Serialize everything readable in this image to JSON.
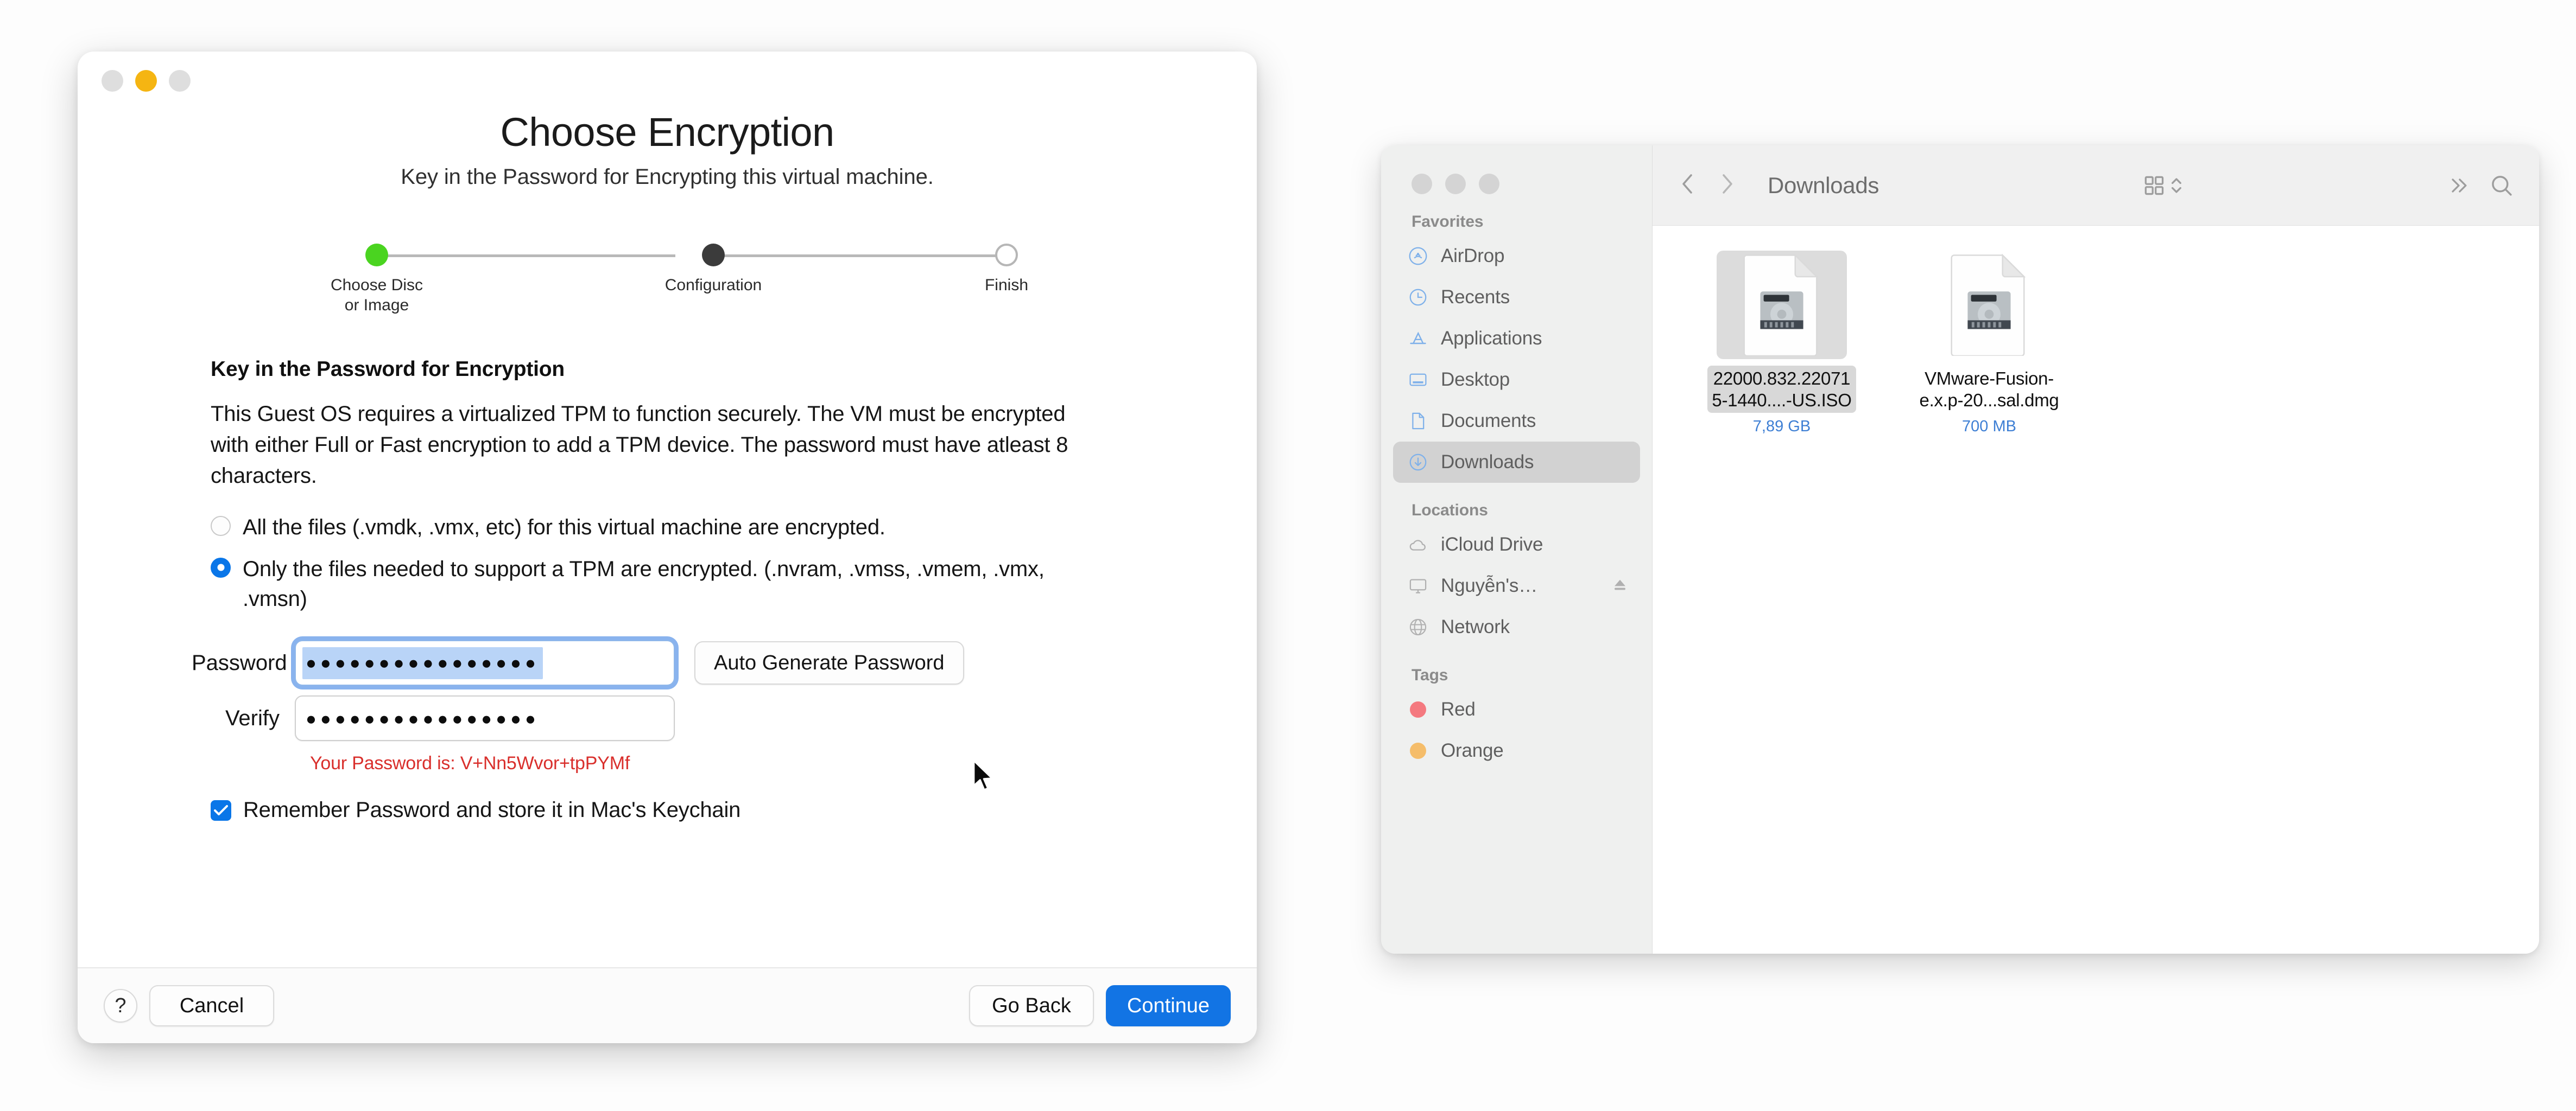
{
  "dialog": {
    "window_controls": {
      "close": "close-button",
      "minimize": "minimize-button",
      "zoom": "zoom-button"
    },
    "title": "Choose Encryption",
    "subtitle": "Key in the Password for Encrypting this virtual machine.",
    "stepper": {
      "steps": [
        {
          "label": "Choose Disc\nor Image",
          "state": "done"
        },
        {
          "label": "Configuration",
          "state": "current"
        },
        {
          "label": "Finish",
          "state": "todo"
        }
      ]
    },
    "section_heading": "Key in the Password for Encryption",
    "section_paragraph": "This Guest OS requires a virtualized TPM to function securely. The VM must be encrypted with either Full or Fast encryption to add a TPM device. The password must have atleast 8 characters.",
    "radio_options": [
      {
        "label": "All the files (.vmdk, .vmx, etc) for this virtual machine are encrypted.",
        "selected": false
      },
      {
        "label": "Only the files needed to support a TPM are encrypted. (.nvram, .vmss, .vmem, .vmx, .vmsn)",
        "selected": true
      }
    ],
    "password_label": "Password",
    "password_value": "●●●●●●●●●●●●●●●●",
    "verify_label": "Verify",
    "verify_value": "●●●●●●●●●●●●●●●●",
    "auto_generate_label": "Auto Generate Password",
    "password_hint": "Your Password is: V+Nn5Wvor+tpPYMf",
    "password_plain": "V+Nn5Wvor+tpPYMf",
    "remember_label": "Remember Password and store it in Mac's Keychain",
    "remember_checked": true,
    "footer": {
      "help_label": "?",
      "cancel_label": "Cancel",
      "go_back_label": "Go Back",
      "continue_label": "Continue"
    },
    "colors": {
      "accent_blue": "#1274e4",
      "radio_blue": "#0a76e8",
      "hint_red": "#d92f2c",
      "step_done_green": "#4ad420",
      "step_current_dark": "#3b3b3b",
      "minimize_yellow": "#f5b512"
    }
  },
  "finder": {
    "toolbar": {
      "title": "Downloads",
      "back_icon": "chevron-left-icon",
      "forward_icon": "chevron-right-icon",
      "view_icon": "grid-view-icon",
      "sort_icon": "chevron-up-down-icon",
      "overflow_icon": "chevron-double-right-icon",
      "search_icon": "search-icon"
    },
    "sidebar": {
      "groups": [
        {
          "heading": "Favorites",
          "items": [
            {
              "label": "AirDrop",
              "icon": "airdrop-icon",
              "active": false
            },
            {
              "label": "Recents",
              "icon": "clock-icon",
              "active": false
            },
            {
              "label": "Applications",
              "icon": "applications-icon",
              "active": false
            },
            {
              "label": "Desktop",
              "icon": "desktop-icon",
              "active": false
            },
            {
              "label": "Documents",
              "icon": "document-icon",
              "active": false
            },
            {
              "label": "Downloads",
              "icon": "downloads-icon",
              "active": true
            }
          ]
        },
        {
          "heading": "Locations",
          "items": [
            {
              "label": "iCloud Drive",
              "icon": "cloud-icon",
              "active": false
            },
            {
              "label": "Nguyễn's…",
              "icon": "display-icon",
              "active": false,
              "eject": true
            },
            {
              "label": "Network",
              "icon": "globe-icon",
              "active": false
            }
          ]
        },
        {
          "heading": "Tags",
          "items": [
            {
              "label": "Red",
              "icon": "tag-dot-icon",
              "color": "#f4797f",
              "active": false
            },
            {
              "label": "Orange",
              "icon": "tag-dot-icon",
              "color": "#f5bd6a",
              "active": false
            }
          ]
        }
      ]
    },
    "files": [
      {
        "name": "22000.832.220715-1440....-US.ISO",
        "name_line1": "22000.832.22071",
        "name_line2": "5-1440....-US.ISO",
        "size": "7,89 GB",
        "icon": "disk-image-file-icon",
        "selected": true
      },
      {
        "name": "VMware-Fusion-e.x.p-20...sal.dmg",
        "name_line1": "VMware-Fusion-",
        "name_line2": "e.x.p-20...sal.dmg",
        "size": "700 MB",
        "icon": "disk-image-file-icon",
        "selected": false
      }
    ]
  },
  "cursor": {
    "icon": "arrow-cursor-icon"
  }
}
